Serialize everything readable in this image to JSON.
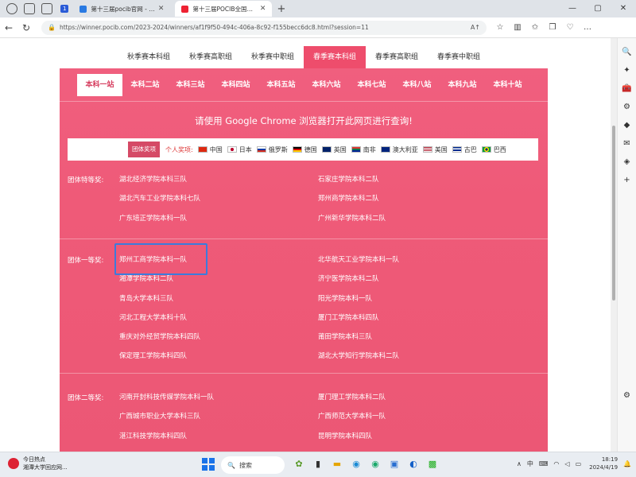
{
  "browser": {
    "tab_count": "1",
    "tabs": [
      {
        "label": "第十三届pocib官网 - 搜索"
      },
      {
        "label": "第十三届POCIB全国外贸从业能力大赛"
      }
    ],
    "url": "https://winner.pocib.com/2023-2024/winners/af1f9f50-494c-406a-8c92-f155becc6dc8.html?session=11"
  },
  "season_nav": [
    {
      "label": "秋季赛本科组"
    },
    {
      "label": "秋季赛高职组"
    },
    {
      "label": "秋季赛中职组"
    },
    {
      "label": "春季赛本科组"
    },
    {
      "label": "春季赛高职组"
    },
    {
      "label": "春季赛中职组"
    }
  ],
  "station_nav": [
    {
      "label": "本科一站"
    },
    {
      "label": "本科二站"
    },
    {
      "label": "本科三站"
    },
    {
      "label": "本科四站"
    },
    {
      "label": "本科五站"
    },
    {
      "label": "本科六站"
    },
    {
      "label": "本科七站"
    },
    {
      "label": "本科八站"
    },
    {
      "label": "本科九站"
    },
    {
      "label": "本科十站"
    }
  ],
  "notice": "请使用 Google Chrome 浏览器打开此网页进行查询!",
  "filter": {
    "team_label": "团体奖项",
    "individual_label": "个人奖项:",
    "countries": [
      {
        "name": "中国"
      },
      {
        "name": "日本"
      },
      {
        "name": "俄罗斯"
      },
      {
        "name": "德国"
      },
      {
        "name": "英国"
      },
      {
        "name": "南非"
      },
      {
        "name": "澳大利亚"
      },
      {
        "name": "美国"
      },
      {
        "name": "古巴"
      },
      {
        "name": "巴西"
      }
    ]
  },
  "awards": {
    "special": {
      "label": "团体特等奖:",
      "col1": [
        "湖北经济学院本科三队",
        "湖北汽车工业学院本科七队",
        "广东培正学院本科一队"
      ],
      "col2": [
        "石家庄学院本科二队",
        "郑州商学院本科二队",
        "广州新华学院本科二队"
      ]
    },
    "first": {
      "label": "团体一等奖:",
      "col1": [
        "郑州工商学院本科一队",
        "湘潭学院本科二队",
        "青岛大学本科三队",
        "河北工程大学本科十队",
        "重庆对外经贸学院本科四队",
        "保定理工学院本科四队"
      ],
      "col2": [
        "北华航天工业学院本科一队",
        "济宁医学院本科二队",
        "阳光学院本科一队",
        "厦门工学院本科四队",
        "莆田学院本科三队",
        "湖北大学知行学院本科二队"
      ]
    },
    "second": {
      "label": "团体二等奖:",
      "col1": [
        "河南开封科技传媒学院本科一队",
        "广西城市职业大学本科三队",
        "湛江科技学院本科四队"
      ],
      "col2": [
        "厦门理工学院本科二队",
        "广西师范大学本科一队",
        "昆明学院本科四队"
      ]
    }
  },
  "taskbar": {
    "news_title": "今日热点",
    "news_sub": "湘潭大学回应网...",
    "search_placeholder": "搜索",
    "ime": "中",
    "time": "18:19",
    "date": "2024/4/19"
  }
}
